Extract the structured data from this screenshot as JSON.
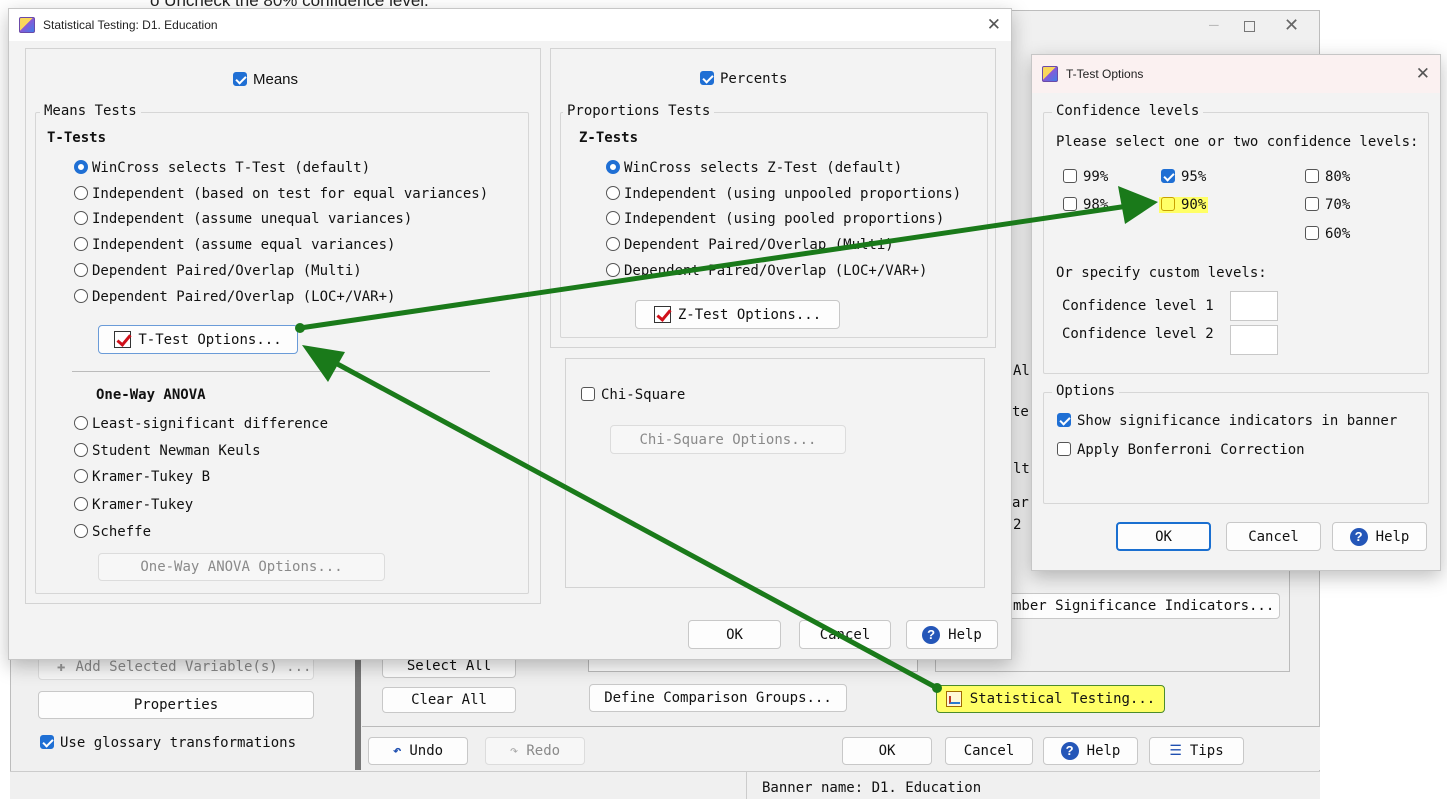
{
  "top_hint": "o  Uncheck the 80% confidence level.",
  "background_window": {
    "left_buttons": {
      "add_selected": "Add Selected Variable(s) ...",
      "properties": "Properties"
    },
    "glossary_checkbox": "Use glossary transformations",
    "select_all": "Select All",
    "clear_all": "Clear All",
    "define_comparison": "Define Comparison Groups...",
    "statistical_testing": "Statistical Testing...",
    "number_sig_indicators": "mber Significance Indicators...",
    "undo": "Undo",
    "redo": "Redo",
    "ok": "OK",
    "cancel": "Cancel",
    "help": "Help",
    "tips": "Tips",
    "status_bar": "Banner name: D1. Education",
    "partial_labels": [
      "Al",
      "te",
      "lt",
      "ar",
      "2"
    ]
  },
  "stat_dialog": {
    "title": "Statistical Testing: D1. Education",
    "means_checkbox": "Means",
    "means_tests_group": "Means Tests",
    "ttests_heading": "T-Tests",
    "ttest_options": [
      {
        "label": "WinCross selects T-Test (default)",
        "checked": true
      },
      {
        "label": "Independent (based on test for equal variances)",
        "checked": false
      },
      {
        "label": "Independent (assume unequal variances)",
        "checked": false
      },
      {
        "label": "Independent (assume equal variances)",
        "checked": false
      },
      {
        "label": "Dependent Paired/Overlap (Multi)",
        "checked": false
      },
      {
        "label": "Dependent Paired/Overlap (LOC+/VAR+)",
        "checked": false
      }
    ],
    "ttest_options_button": "T-Test Options...",
    "anova_heading": "One-Way ANOVA",
    "anova_options": [
      "Least-significant difference",
      "Student Newman Keuls",
      "Kramer-Tukey B",
      "Kramer-Tukey",
      "Scheffe"
    ],
    "anova_options_button": "One-Way ANOVA Options...",
    "percents_checkbox": "Percents",
    "proportions_group": "Proportions Tests",
    "ztests_heading": "Z-Tests",
    "ztest_options": [
      {
        "label": "WinCross selects Z-Test (default)",
        "checked": true
      },
      {
        "label": "Independent (using unpooled proportions)",
        "checked": false
      },
      {
        "label": "Independent (using pooled proportions)",
        "checked": false
      },
      {
        "label": "Dependent Paired/Overlap (Multi)",
        "checked": false
      },
      {
        "label": "Dependent Paired/Overlap (LOC+/VAR+)",
        "checked": false
      }
    ],
    "ztest_options_button": "Z-Test Options...",
    "chi_square_checkbox": "Chi-Square",
    "chi_square_button": "Chi-Square Options...",
    "ok": "OK",
    "cancel": "Cancel",
    "help": "Help"
  },
  "ttest_dialog": {
    "title": "T-Test Options",
    "confidence_group": "Confidence levels",
    "instruction": "Please select one or two confidence levels:",
    "levels": {
      "l99": {
        "label": "99%",
        "checked": false
      },
      "l95": {
        "label": "95%",
        "checked": true
      },
      "l80": {
        "label": "80%",
        "checked": false
      },
      "l98": {
        "label": "98%",
        "checked": false
      },
      "l90": {
        "label": "90%",
        "checked": false
      },
      "l70": {
        "label": "70%",
        "checked": false
      },
      "l60": {
        "label": "60%",
        "checked": false
      }
    },
    "custom_label": "Or specify custom levels:",
    "custom_level_1": "Confidence level 1",
    "custom_level_2": "Confidence level 2",
    "options_group": "Options",
    "show_sig": "Show significance indicators in banner",
    "bonferroni": "Apply Bonferroni Correction",
    "ok": "OK",
    "cancel": "Cancel",
    "help": "Help"
  },
  "colors": {
    "accent": "#1f6fd4",
    "highlight": "#ffff66",
    "arrow": "#1a7a1a"
  }
}
